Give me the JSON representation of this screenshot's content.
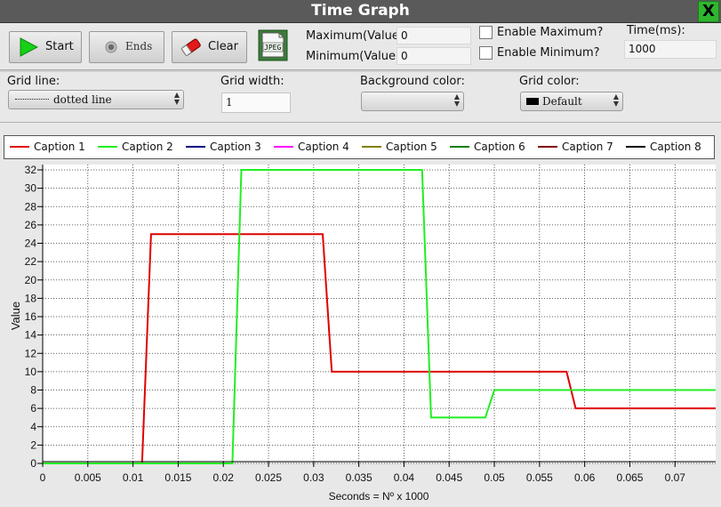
{
  "window": {
    "title": "Time Graph",
    "close_label": "X"
  },
  "toolbar": {
    "start_label": "Start",
    "ends_label": "Ends",
    "clear_label": "Clear",
    "jpeg_label": "JPEG",
    "maximum_label": "Maximum(Value):",
    "maximum_value": "0",
    "minimum_label": "Minimum(Value):",
    "minimum_value": "0",
    "enable_max_label": "Enable Maximum?",
    "enable_min_label": "Enable Minimum?",
    "time_label": "Time(ms):",
    "time_value": "1000"
  },
  "settings": {
    "grid_line_label": "Grid line:",
    "grid_line_value": "dotted line",
    "grid_width_label": "Grid width:",
    "grid_width_value": "1",
    "background_color_label": "Background color:",
    "background_color_value": "",
    "grid_color_label": "Grid color:",
    "grid_color_value": "Default"
  },
  "legend": [
    {
      "name": "Caption 1",
      "color": "#e00000"
    },
    {
      "name": "Caption 2",
      "color": "#22ee22"
    },
    {
      "name": "Caption 3",
      "color": "#000080"
    },
    {
      "name": "Caption 4",
      "color": "#ff00ff"
    },
    {
      "name": "Caption 5",
      "color": "#808000"
    },
    {
      "name": "Caption 6",
      "color": "#008000"
    },
    {
      "name": "Caption 7",
      "color": "#800000"
    },
    {
      "name": "Caption 8",
      "color": "#000000"
    }
  ],
  "chart_data": {
    "type": "line",
    "xlabel": "Seconds = Nº x 1000",
    "ylabel": "Value",
    "xlim": [
      0,
      0.0745
    ],
    "ylim": [
      0,
      32
    ],
    "x_ticks": [
      "0",
      "0.005",
      "0.01",
      "0.015",
      "0.02",
      "0.025",
      "0.03",
      "0.035",
      "0.04",
      "0.045",
      "0.05",
      "0.055",
      "0.06",
      "0.065",
      "0.07"
    ],
    "y_ticks": [
      "0",
      "2",
      "4",
      "6",
      "8",
      "10",
      "12",
      "14",
      "16",
      "18",
      "20",
      "22",
      "24",
      "26",
      "28",
      "30",
      "32"
    ],
    "grid": "dotted",
    "series": [
      {
        "name": "Caption 1",
        "color": "#e00000",
        "x": [
          0,
          0.011,
          0.012,
          0.031,
          0.032,
          0.058,
          0.059,
          0.0745
        ],
        "y": [
          0,
          0,
          25,
          25,
          10,
          10,
          6,
          6
        ]
      },
      {
        "name": "Caption 2",
        "color": "#22ee22",
        "x": [
          0,
          0.021,
          0.022,
          0.042,
          0.043,
          0.049,
          0.05,
          0.0745
        ],
        "y": [
          0,
          0,
          32,
          32,
          5,
          5,
          8,
          8
        ]
      }
    ]
  }
}
